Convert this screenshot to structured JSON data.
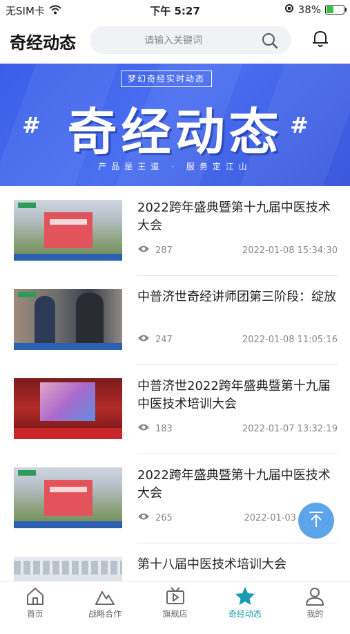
{
  "status_bar": {
    "carrier": "无SIM卡",
    "time": "下午 5:27",
    "battery_percent": "38%",
    "battery_level": 0.38
  },
  "header": {
    "title": "奇经动态",
    "search_placeholder": "请输入关键词"
  },
  "banner": {
    "tag": "梦幻奇经实时动态",
    "title": "奇经动态",
    "hash_left": "#",
    "hash_right": "#",
    "subtitle": "产品是王道 · 服务定江山"
  },
  "news": [
    {
      "title": "2022跨年盛典暨第十九届中医技术大会",
      "views": "287",
      "date": "2022-01-08 15:34:30"
    },
    {
      "title": "中普济世奇经讲师团第三阶段：绽放",
      "views": "247",
      "date": "2022-01-08 11:05:16"
    },
    {
      "title": "中普济世2022跨年盛典暨第十九届中医技术培训大会",
      "views": "183",
      "date": "2022-01-07 13:32:19"
    },
    {
      "title": "2022跨年盛典暨第十九届中医技术大会",
      "views": "265",
      "date": "2022-01-03"
    },
    {
      "title": "第十八届中医技术培训大会",
      "views": "",
      "date": ""
    }
  ],
  "tabs": [
    {
      "label": "首页",
      "icon": "home-icon"
    },
    {
      "label": "战略合作",
      "icon": "mountain-icon"
    },
    {
      "label": "旗舰店",
      "icon": "video-icon"
    },
    {
      "label": "奇经动态",
      "icon": "star-icon"
    },
    {
      "label": "我的",
      "icon": "user-icon"
    }
  ],
  "colors": {
    "accent": "#1a9bb0",
    "banner_blue": "#3a5ee8",
    "fab": "#4095e6"
  }
}
